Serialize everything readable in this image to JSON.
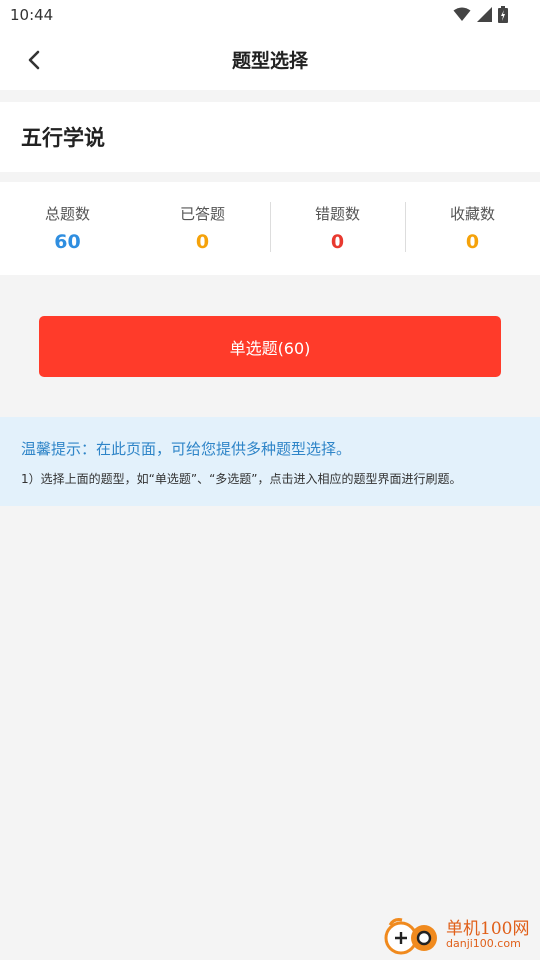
{
  "status_bar": {
    "time": "10:44",
    "icons": [
      "wifi-icon",
      "signal-icon",
      "battery-icon"
    ]
  },
  "nav": {
    "title": "题型选择",
    "back_icon": "chevron-left-icon"
  },
  "subject": {
    "title": "五行学说"
  },
  "stats": [
    {
      "label": "总题数",
      "value": "60",
      "color": "#2f8ee0"
    },
    {
      "label": "已答题",
      "value": "0",
      "color": "#f5a20a"
    },
    {
      "label": "错题数",
      "value": "0",
      "color": "#e8392f"
    },
    {
      "label": "收藏数",
      "value": "0",
      "color": "#f5a20a"
    }
  ],
  "actions": {
    "single_choice_label": "单选题(60)"
  },
  "tips": {
    "title": "温馨提示：在此页面，可给您提供多种题型选择。",
    "body": "1）选择上面的题型，如“单选题”、“多选题”，点击进入相应的题型界面进行刷题。"
  },
  "watermark": {
    "text": "单机100网",
    "sub": "danji100.com"
  },
  "colors": {
    "accent_button": "#ff3b2a",
    "tips_background": "#e3f1fb",
    "tips_title": "#2f85c8"
  }
}
